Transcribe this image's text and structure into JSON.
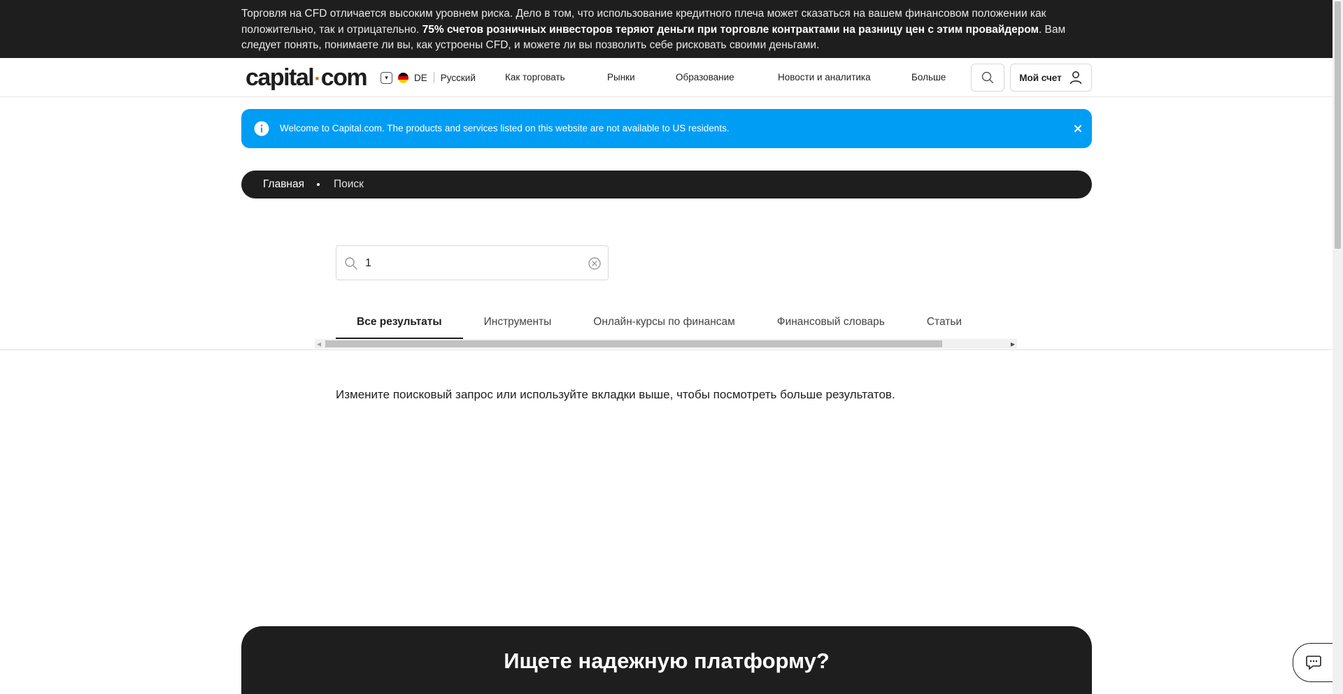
{
  "risk_banner": {
    "text_before": "Торговля на CFD отличается высоким уровнем риска. Дело в том, что использование кредитного плеча может сказаться на вашем финансовом положении как положительно, так и отрицательно. ",
    "text_bold": "75% счетов розничных инвесторов теряют деньги при торговле контрактами на разницу цен с этим провайдером",
    "text_after": ". Вам следует понять, понимаете ли вы, как устроены CFD, и можете ли вы позволить себе рисковать своими деньгами."
  },
  "header": {
    "logo_left": "capital",
    "logo_dot": "·",
    "logo_right": "com",
    "region": "DE",
    "language": "Русский",
    "nav": [
      "Как торговать",
      "Рынки",
      "Образование",
      "Новости и аналитика",
      "Больше"
    ],
    "account_label": "Мой счет"
  },
  "welcome": {
    "message": "Welcome to Capital.com. The products and services listed on this website are not available to US residents."
  },
  "breadcrumb": {
    "home": "Главная",
    "current": "Поиск"
  },
  "search": {
    "value": "1"
  },
  "tabs": [
    "Все результаты",
    "Инструменты",
    "Онлайн-курсы по финансам",
    "Финансовый словарь",
    "Статьи"
  ],
  "hint": "Измените поисковый запрос или используйте вкладки выше, чтобы посмотреть больше результатов.",
  "promo": {
    "title": "Ищете надежную платформу?"
  },
  "colors": {
    "dark": "#1e1e1e",
    "accent_blue": "#009df5",
    "logo_dot": "#d0721d"
  }
}
